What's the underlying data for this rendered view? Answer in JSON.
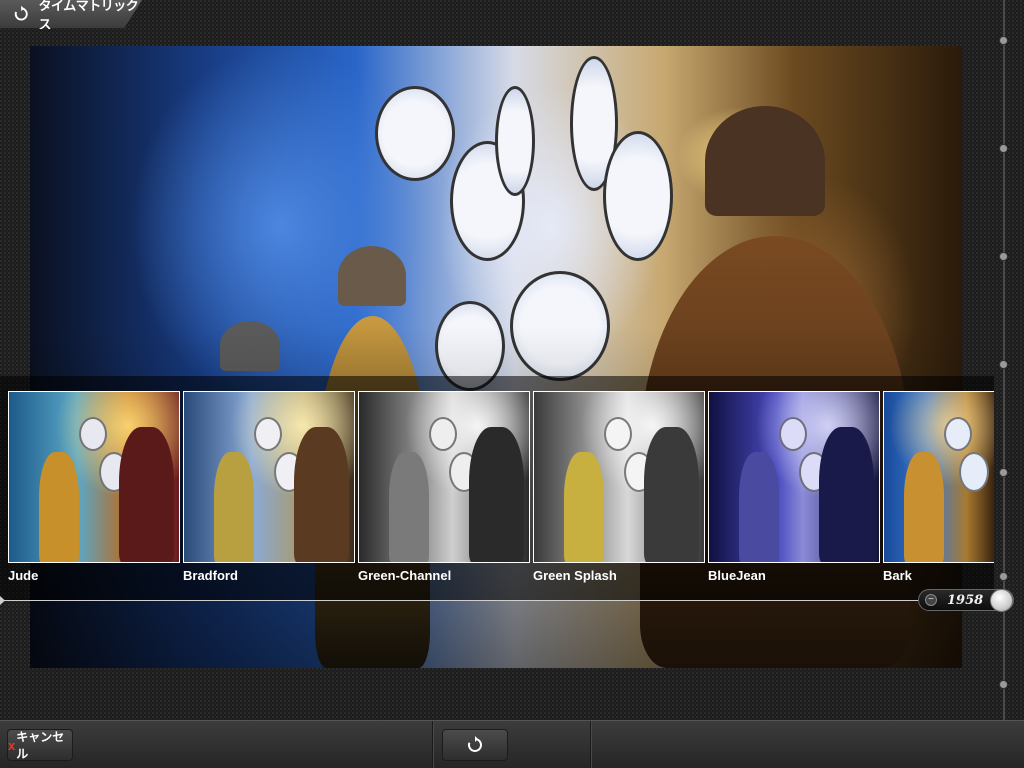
{
  "app": {
    "title": "タイムマトリックス",
    "icon": "rotate-icon"
  },
  "filters": [
    {
      "label": "Jude",
      "tint": "#c98a2a"
    },
    {
      "label": "Bradford",
      "tint": "#8a8a6a"
    },
    {
      "label": "Green-Channel",
      "tint": "#8c8c8c"
    },
    {
      "label": "Green Splash",
      "tint": "#9a9a9a"
    },
    {
      "label": "BlueJean",
      "tint": "#3c3ca0"
    },
    {
      "label": "Bark",
      "tint": "#2a5aa8"
    }
  ],
  "slider": {
    "year": "1958",
    "minus_icon": "minus-icon"
  },
  "toolbar": {
    "cancel_label": "キャンセル",
    "cancel_icon": "x",
    "reset_icon": "rotate-icon"
  }
}
